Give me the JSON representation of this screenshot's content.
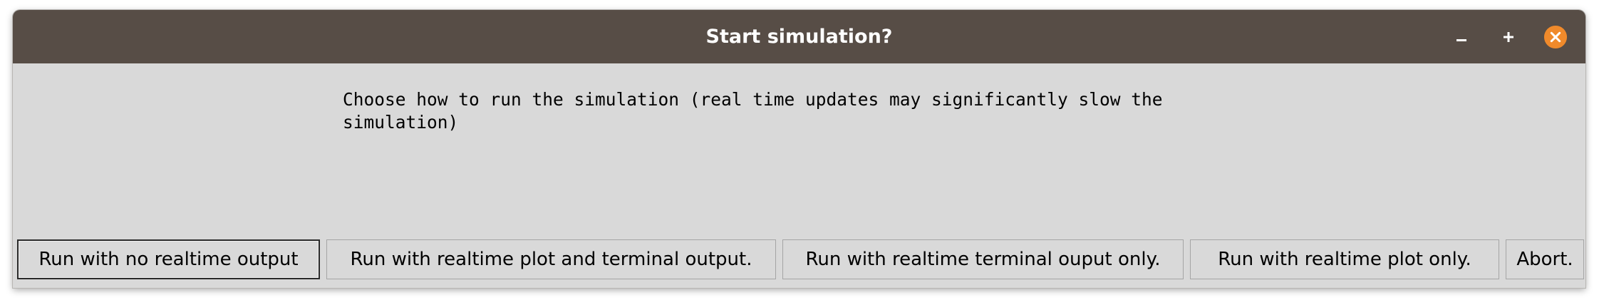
{
  "window": {
    "title": "Start simulation?"
  },
  "titlebar_controls": {
    "minimize_icon": "minimize-icon",
    "maximize_icon": "maximize-icon",
    "close_icon": "close-icon",
    "close_color": "#f08a2b",
    "titlebar_color": "#574d46"
  },
  "message": {
    "line1": "Choose how to run the simulation (real time updates may significantly slow the",
    "line2": "simulation)"
  },
  "buttons": [
    {
      "label": "Run with no realtime output",
      "default": true
    },
    {
      "label": "Run with realtime plot and terminal output.",
      "default": false
    },
    {
      "label": "Run with realtime terminal ouput only.",
      "default": false
    },
    {
      "label": "Run with realtime plot only.",
      "default": false
    },
    {
      "label": "Abort.",
      "default": false
    }
  ]
}
